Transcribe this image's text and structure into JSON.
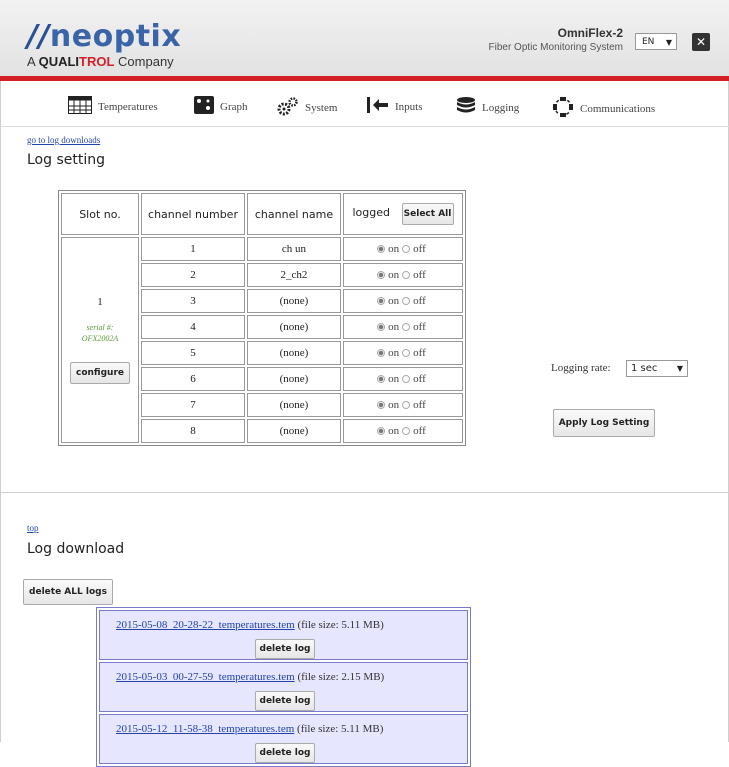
{
  "header": {
    "logo_text": "neoptix",
    "company_prefix": "A ",
    "company_q": "QUALI",
    "company_trol": "TROL",
    "company_suffix": " Company",
    "product_name": "OmniFlex-2",
    "product_desc": "Fiber Optic Monitoring System",
    "language": "EN",
    "close_icon": "close-icon",
    "brand_red": "#d51f26",
    "brand_blue": "#3a64a8"
  },
  "nav": {
    "items": [
      {
        "label": "Temperatures",
        "icon": "table-icon"
      },
      {
        "label": "Graph",
        "icon": "graph-icon"
      },
      {
        "label": "System",
        "icon": "gears-icon"
      },
      {
        "label": "Inputs",
        "icon": "input-arrow-icon"
      },
      {
        "label": "Logging",
        "icon": "database-icon"
      },
      {
        "label": "Communications",
        "icon": "network-icon"
      }
    ]
  },
  "log_setting": {
    "goto_link": "go to log downloads",
    "title": "Log setting",
    "columns": {
      "slot": "Slot no.",
      "channel_number": "channel number",
      "channel_name": "channel name",
      "logged": "logged"
    },
    "select_all_label": "Select All",
    "slot": {
      "number": "1",
      "serial_label": "serial #:",
      "serial_value": "OFX2002A",
      "configure_label": "configure"
    },
    "on_label": "on",
    "off_label": "off",
    "channels": [
      {
        "number": "1",
        "name": "ch un",
        "logged": "on"
      },
      {
        "number": "2",
        "name": "2_ch2",
        "logged": "on"
      },
      {
        "number": "3",
        "name": "(none)",
        "logged": "on"
      },
      {
        "number": "4",
        "name": "(none)",
        "logged": "on"
      },
      {
        "number": "5",
        "name": "(none)",
        "logged": "on"
      },
      {
        "number": "6",
        "name": "(none)",
        "logged": "on"
      },
      {
        "number": "7",
        "name": "(none)",
        "logged": "on"
      },
      {
        "number": "8",
        "name": "(none)",
        "logged": "on"
      }
    ],
    "logging_rate_label": "Logging rate:",
    "logging_rate_value": "1 sec",
    "apply_label": "Apply Log Setting"
  },
  "log_download": {
    "top_link": "top",
    "title": "Log download",
    "delete_all_label": "delete ALL logs",
    "delete_label": "delete log",
    "files": [
      {
        "name": "2015-05-08_20-28-22_temperatures.tem",
        "size": "(file size: 5.11 MB)"
      },
      {
        "name": "2015-05-03_00-27-59_temperatures.tem",
        "size": "(file size: 2.15 MB)"
      },
      {
        "name": "2015-05-12_11-58-38_temperatures.tem",
        "size": "(file size: 5.11 MB)"
      }
    ]
  }
}
